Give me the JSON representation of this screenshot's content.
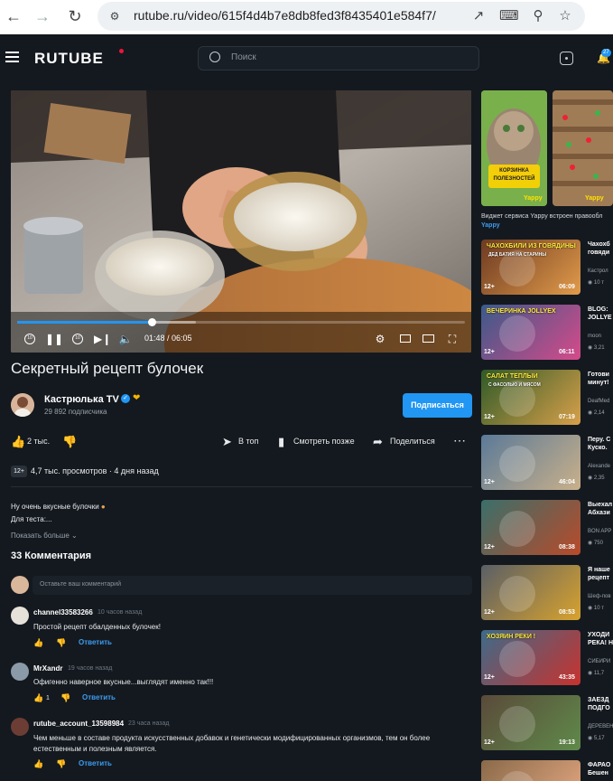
{
  "browser": {
    "url": "rutube.ru/video/615f4d4b7e8db8fed3f8435401e584f7/"
  },
  "header": {
    "logo": "RUTUBE",
    "search_placeholder": "Поиск",
    "notification_count": "27"
  },
  "player": {
    "time": "01:48 / 06:05",
    "progress": 0.3,
    "buffered": 0.4
  },
  "video": {
    "title": "Секретный рецепт булочек",
    "channel": "Кастрюлька TV",
    "subscribers": "29 892 подписчика",
    "subscribe_label": "Подписаться",
    "likes": "2 тыс.",
    "to_top_label": "В топ",
    "watch_later_label": "Смотреть позже",
    "share_label": "Поделиться",
    "age_rating": "12+",
    "views": "4,7 тыс. просмотров",
    "posted": "4 дня назад",
    "desc_line1": "Ну очень вкусные булочки",
    "desc_line2": "Для теста:...",
    "show_more": "Показать больше"
  },
  "comments": {
    "title": "33 Комментария",
    "placeholder": "Оставьте ваш комментарий",
    "reply_label": "Ответить",
    "items": [
      {
        "user": "channel33583266",
        "time": "10 часов назад",
        "text": "Простой рецепт обалденных булочек!",
        "likes": ""
      },
      {
        "user": "MrXandr",
        "time": "19 часов назад",
        "text": "Офигенно наверное вкусные...выглядят именно так!!!",
        "likes": "1"
      },
      {
        "user": "rutube_account_13598984",
        "time": "23 часа назад",
        "text": "Чем меньше в составе продукта искусственных добавок и генетически модифицированных организмов, тем он более",
        "text2": "естественным и полезным является.",
        "likes": ""
      }
    ]
  },
  "widget": {
    "caption": "Виджет сервиса Yappy встроен правообл",
    "brand": "Yappy",
    "thumb1_text": "КОРЗИНКА ПОЛЕЗНОСТЕЙ",
    "thumb1_label": "Yappy",
    "thumb2_label": "Yappy"
  },
  "related": [
    {
      "title1": "Чахохб",
      "title2": "говяди",
      "channel": "Кастрол",
      "views": "10 т",
      "duration": "06:09",
      "age": "12+",
      "overlay": "ЧАХОХБИЛИ ИЗ ГОВЯДИНЫ",
      "overlay2": "ДЕД БАТИЯ НА СТАРИНЫ"
    },
    {
      "title1": "BLOG: ",
      "title2": "JOLLYE",
      "channel": "moon",
      "views": "3,21",
      "duration": "06:11",
      "age": "12+",
      "overlay": "ВЕЧЕРИНКА JOLLYEX",
      "overlay2": ""
    },
    {
      "title1": "Готови",
      "title2": "минут!",
      "channel": "DeafMed",
      "views": "2,14",
      "duration": "07:19",
      "age": "12+",
      "overlay": "САЛАТ ТЁПЛЫЙ",
      "overlay2": "С ФАСОЛЬЮ И МЯСОМ"
    },
    {
      "title1": "Перу. С",
      "title2": "Куско.",
      "channel": "Alexande",
      "views": "2,35",
      "duration": "46:04",
      "age": "12+",
      "overlay": "",
      "overlay2": ""
    },
    {
      "title1": "Выехал",
      "title2": "Абхази",
      "channel": "BON APP",
      "views": "750",
      "duration": "08:38",
      "age": "12+",
      "overlay": "",
      "overlay2": ""
    },
    {
      "title1": "Я наше",
      "title2": "рецепт",
      "channel": "Шеф-пов",
      "views": "10 т",
      "duration": "08:53",
      "age": "12+",
      "overlay": "",
      "overlay2": ""
    },
    {
      "title1": "УХОДИ",
      "title2": "РЕКА! Н",
      "channel": "СИБИРИ",
      "views": "11,7",
      "duration": "43:35",
      "age": "12+",
      "overlay": "ХОЗЯИН РЕКИ !",
      "overlay2": ""
    },
    {
      "title1": "ЗАЕЗД ",
      "title2": "ПОДГО",
      "channel": "ДЕРЕВЕН",
      "views": "5,17",
      "duration": "19:13",
      "age": "12+",
      "overlay": "",
      "overlay2": ""
    },
    {
      "title1": "ФАРАО",
      "title2": "Бешен",
      "channel": "",
      "views": "",
      "duration": "",
      "age": "",
      "overlay": "",
      "overlay2": ""
    }
  ]
}
